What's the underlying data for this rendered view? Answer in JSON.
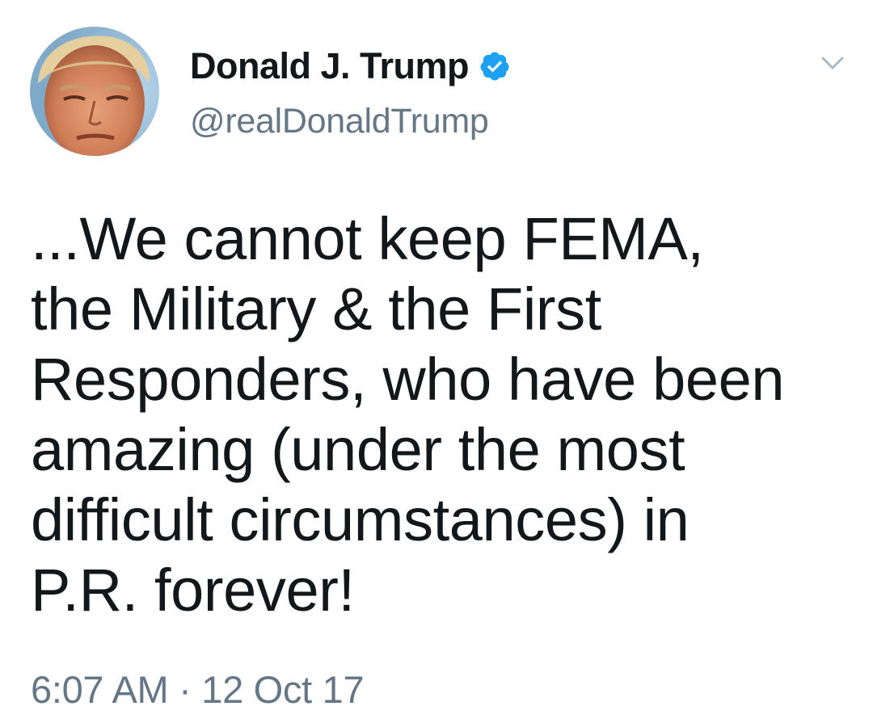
{
  "author": {
    "display_name": "Donald J. Trump",
    "handle": "@realDonaldTrump",
    "verified": true,
    "avatar_icon": "profile-photo"
  },
  "menu": {
    "icon": "chevron-down-icon"
  },
  "tweet": {
    "lines": [
      "...We cannot keep FEMA,",
      "the Military & the First",
      "Responders, who have been",
      "amazing (under the most",
      "difficult circumstances) in",
      "P.R. forever!"
    ]
  },
  "timestamp": {
    "time": "6:07 AM",
    "separator": "·",
    "date": "12 Oct 17"
  },
  "colors": {
    "text": "#14171a",
    "secondary": "#657786",
    "verified_blue": "#1da1f2",
    "background": "#ffffff"
  }
}
